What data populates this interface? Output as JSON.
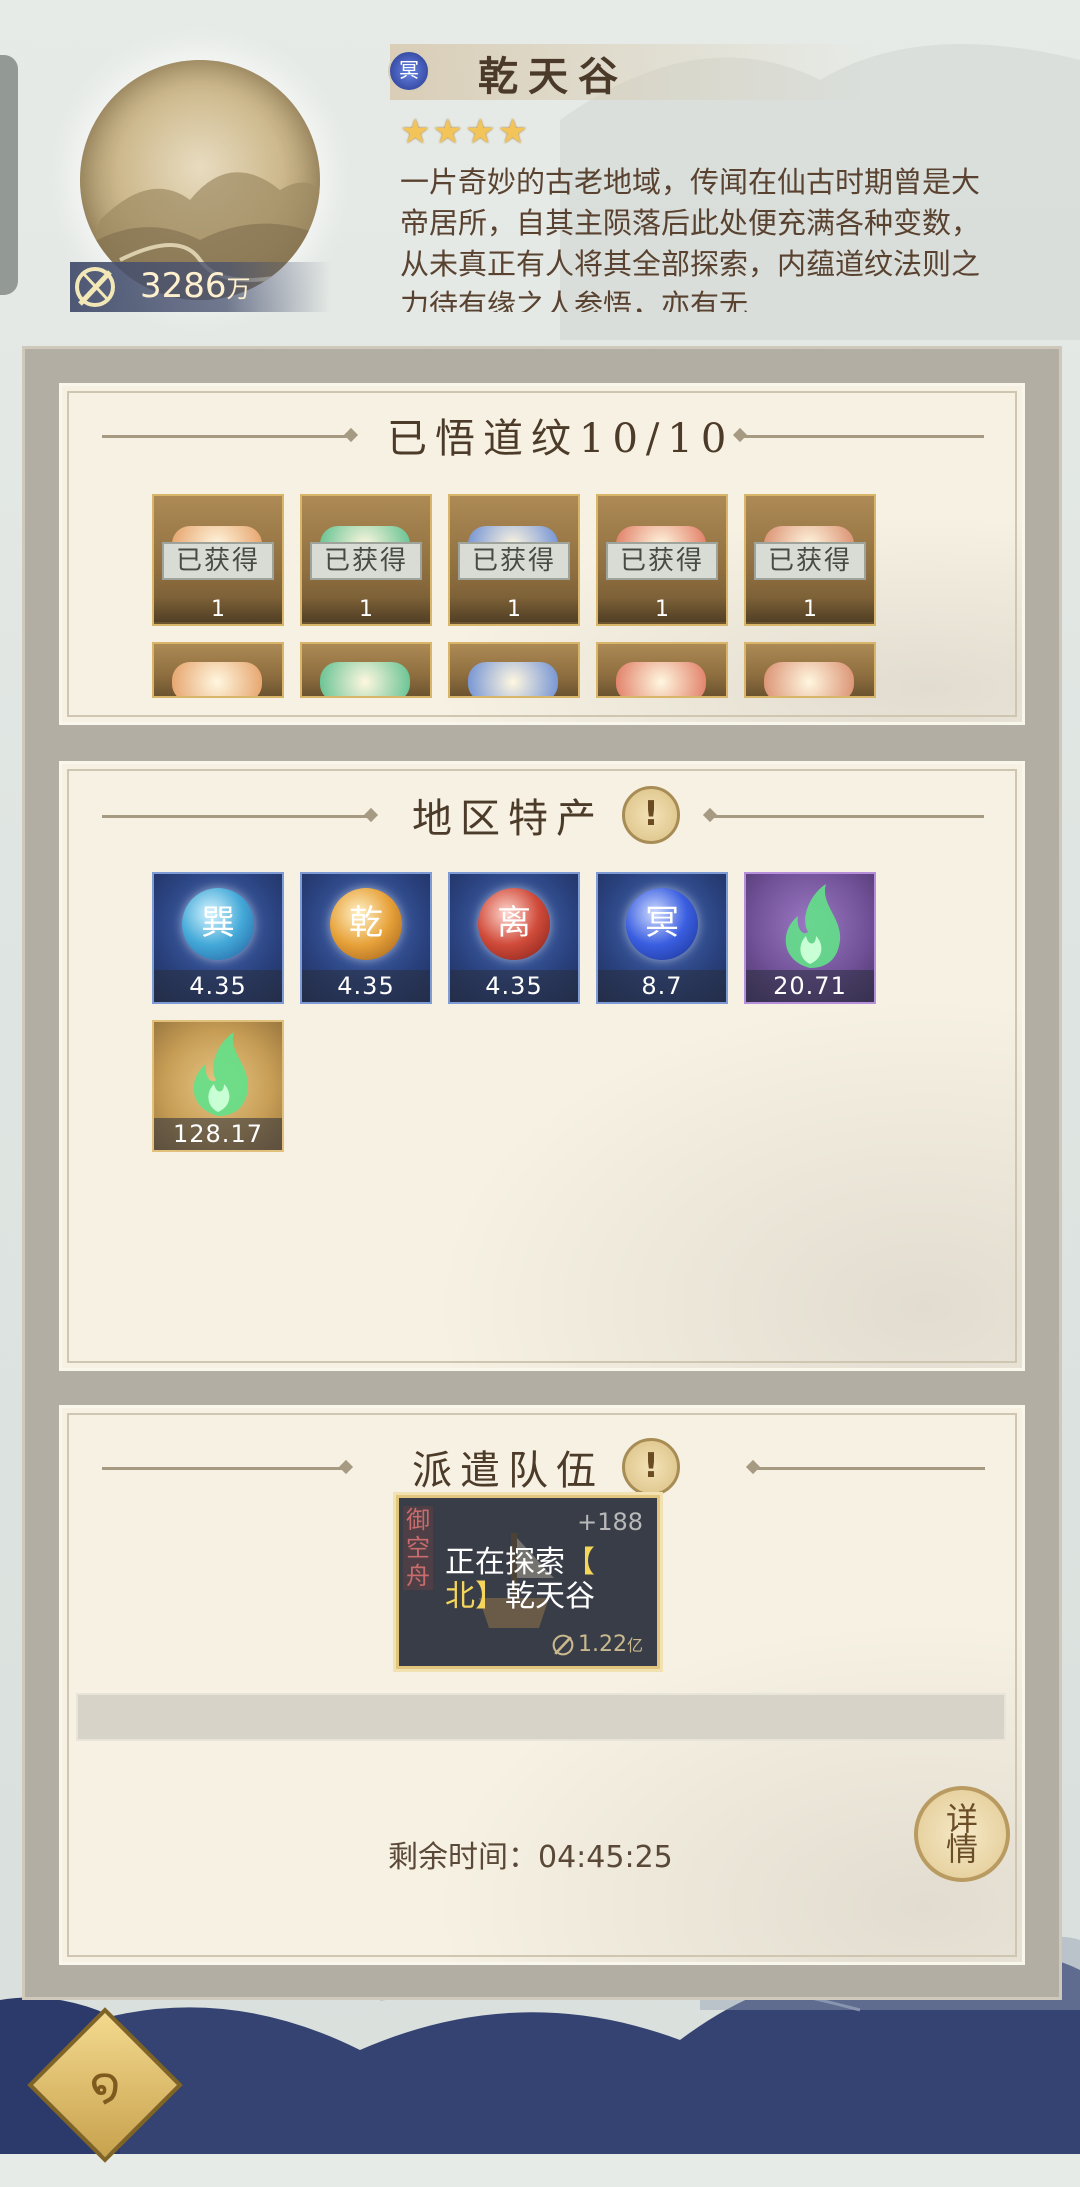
{
  "header": {
    "region_badge": "冥",
    "title": "乾天谷",
    "stars": 4,
    "description": "一片奇妙的古老地域，传闻在仙古时期曾是大帝居所，自其主陨落后此处便充满各种变数，从未真正有人将其全部探索，内蕴道纹法则之力待有缘之人参悟，亦有无",
    "power_value": "3286",
    "power_unit": "万"
  },
  "dao_panel": {
    "title": "已悟道纹10/10",
    "obtained_label": "已获得",
    "items": [
      {
        "count": "1",
        "color": "#e5a067"
      },
      {
        "count": "1",
        "color": "#5fc08f"
      },
      {
        "count": "1",
        "color": "#6d8fd4"
      },
      {
        "count": "1",
        "color": "#e07a62"
      },
      {
        "count": "1",
        "color": "#d98d6d"
      }
    ]
  },
  "products_panel": {
    "title": "地区特产",
    "items": [
      {
        "glyph": "巽",
        "value": "4.35"
      },
      {
        "glyph": "乾",
        "value": "4.35"
      },
      {
        "glyph": "离",
        "value": "4.35"
      },
      {
        "glyph": "冥",
        "value": "8.7"
      },
      {
        "glyph": "",
        "value": "20.71"
      },
      {
        "glyph": "",
        "value": "128.17"
      }
    ]
  },
  "dispatch_panel": {
    "title": "派遣队伍",
    "ship_name": "御空舟",
    "ship_bonus": "+188",
    "status_line1": "正在探索",
    "bracket_open": "【",
    "direction": "北",
    "bracket_close": "】",
    "location": "乾天谷",
    "ship_power": "1.22",
    "ship_power_unit": "亿",
    "remaining_label": "剩余时间：",
    "remaining_time": "04:45:25",
    "detail_button": "详情"
  },
  "colors": {
    "panel_bg": "#f6f1e2",
    "container_bg": "#b3aea3",
    "title_text": "#4b3a2a",
    "star": "#f3c45a"
  }
}
